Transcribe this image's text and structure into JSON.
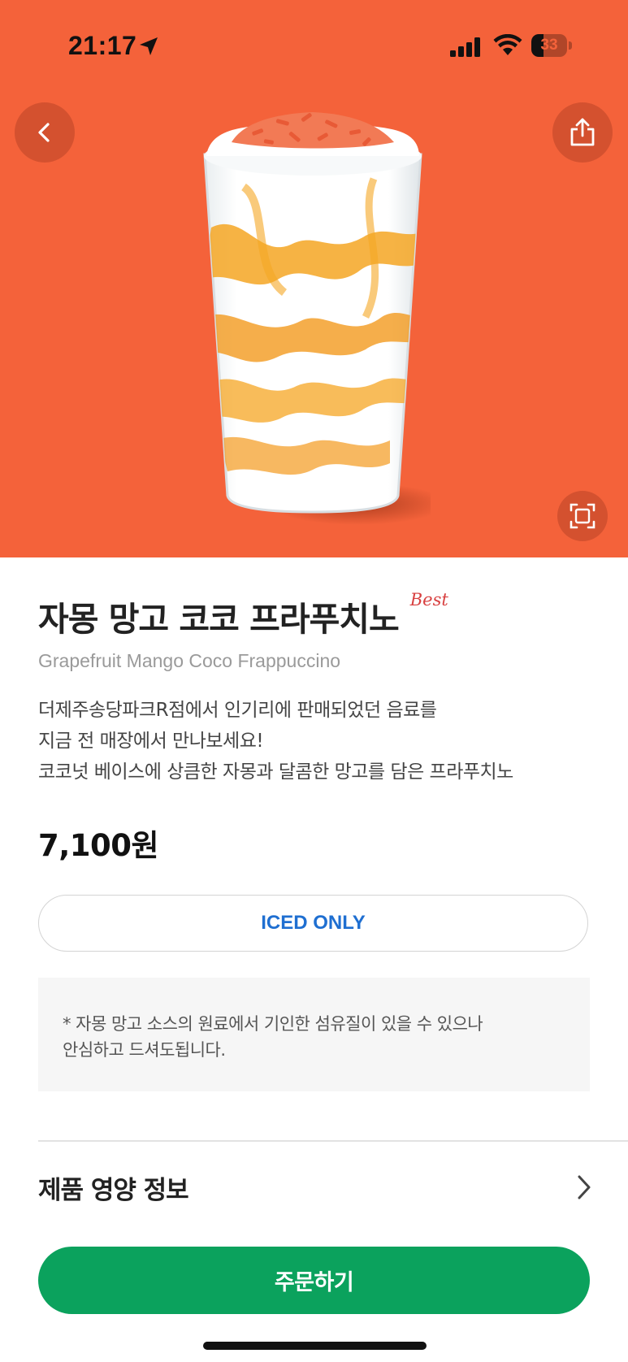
{
  "status_bar": {
    "time": "21:17",
    "battery": "33",
    "battery_level": 0.33
  },
  "hero": {
    "background_color": "#f4623a",
    "back_icon": "chevron-left-icon",
    "share_icon": "share-icon",
    "expand_icon": "fullscreen-icon"
  },
  "product": {
    "name_ko": "자몽 망고 코코 프라푸치노",
    "badge": "Best",
    "name_en": "Grapefruit Mango Coco Frappuccino",
    "description": [
      "더제주송당파크R점에서 인기리에 판매되었던 음료를",
      "지금 전 매장에서 만나보세요!",
      "코코넛 베이스에 상큼한 자몽과 달콤한 망고를 담은 프라푸치노"
    ],
    "price": "7,100원",
    "temperature_option": "ICED ONLY",
    "notice_lines": [
      "* 자몽 망고 소스의 원료에서 기인한 섬유질이 있을 수 있으나",
      "안심하고 드셔도됩니다."
    ]
  },
  "nutrition": {
    "label": "제품 영양 정보",
    "chevron_icon": "chevron-right-icon"
  },
  "order": {
    "button_label": "주문하기",
    "button_color": "#0ba25d"
  }
}
